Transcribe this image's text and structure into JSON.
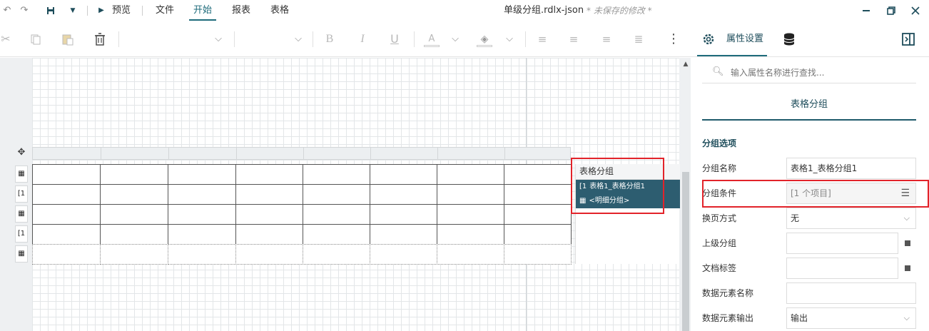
{
  "titlebar": {
    "preview_label": "预览",
    "menu": [
      "文件",
      "开始",
      "报表",
      "表格"
    ],
    "doc_title": "单级分组.rdlx-json",
    "unsaved": "* 未保存的修改 *"
  },
  "toolbar": {
    "icons": [
      "cut-icon",
      "copy-icon",
      "paste-icon",
      "delete-icon",
      "font-family-dropdown",
      "font-size-dropdown",
      "bold-icon",
      "italic-icon",
      "underline-icon",
      "font-color-icon",
      "fill-color-icon",
      "align-left-icon",
      "align-center-icon",
      "align-right-icon",
      "justify-icon",
      "more-icon"
    ]
  },
  "right_header": {
    "tab_label": "属性设置"
  },
  "group_panel": {
    "title": "表格分组",
    "items": [
      {
        "icon": "[1",
        "label": "表格1_表格分组1"
      },
      {
        "icon": "▦",
        "label": "<明细分组>"
      }
    ]
  },
  "row_handles": [
    "▦",
    "[1",
    "▦",
    "[1",
    "▦"
  ],
  "properties": {
    "search_placeholder": "输入属性名称进行查找...",
    "section_title": "表格分组",
    "subsection": "分组选项",
    "rows": [
      {
        "label": "分组名称",
        "value": "表格1_表格分组1"
      },
      {
        "label": "分组条件",
        "value": "[1 个项目]"
      },
      {
        "label": "换页方式",
        "value": "无"
      },
      {
        "label": "上级分组",
        "value": ""
      },
      {
        "label": "文档标签",
        "value": ""
      },
      {
        "label": "数据元素名称",
        "value": ""
      },
      {
        "label": "数据元素输出",
        "value": "输出"
      }
    ]
  },
  "colors": {
    "accent": "#1e5a6b",
    "highlight": "#e2232a"
  }
}
